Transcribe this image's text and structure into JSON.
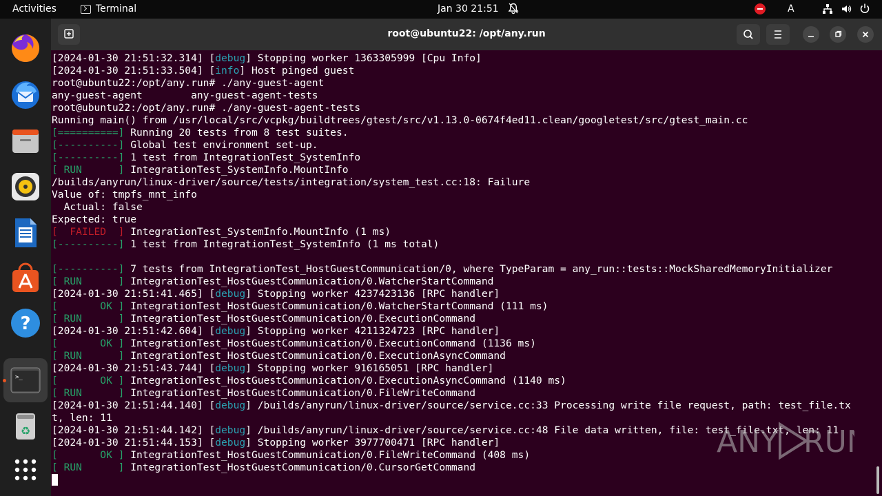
{
  "topbar": {
    "activities": "Activities",
    "app_name": "Terminal",
    "clock": "Jan 30  21:51",
    "keyboard_indicator": "A"
  },
  "dock": {
    "items": [
      {
        "name": "firefox-icon"
      },
      {
        "name": "thunderbird-icon"
      },
      {
        "name": "files-icon"
      },
      {
        "name": "rhythmbox-icon"
      },
      {
        "name": "libreoffice-writer-icon"
      },
      {
        "name": "app-center-icon"
      },
      {
        "name": "help-icon"
      },
      {
        "name": "terminal-icon"
      },
      {
        "name": "trash-icon"
      },
      {
        "name": "show-apps-icon"
      }
    ]
  },
  "window": {
    "title": "root@ubuntu22: /opt/any.run"
  },
  "colors": {
    "background": "#2c001e",
    "debug": "#2aa1b3",
    "green": "#26a269",
    "red": "#c01c28"
  },
  "terminal": {
    "lines": [
      [
        {
          "t": "[2024-01-30 21:51:32.314] ["
        },
        {
          "t": "debug",
          "c": "cyan"
        },
        {
          "t": "] Stopping worker 1363305999 [Cpu Info]"
        }
      ],
      [
        {
          "t": "[2024-01-30 21:51:33.504] ["
        },
        {
          "t": "info",
          "c": "cyan"
        },
        {
          "t": "] Host pinged guest"
        }
      ],
      [
        {
          "t": "root@ubuntu22:/opt/any.run# ./any-guest-agent"
        }
      ],
      [
        {
          "t": "any-guest-agent        any-guest-agent-tests"
        }
      ],
      [
        {
          "t": "root@ubuntu22:/opt/any.run# ./any-guest-agent-tests"
        }
      ],
      [
        {
          "t": "Running main() from /usr/local/src/vcpkg/buildtrees/gtest/src/v1.13.0-0674f4ed11.clean/googletest/src/gtest_main.cc"
        }
      ],
      [
        {
          "t": "[==========]",
          "c": "green"
        },
        {
          "t": " Running 20 tests from 8 test suites."
        }
      ],
      [
        {
          "t": "[----------]",
          "c": "green"
        },
        {
          "t": " Global test environment set-up."
        }
      ],
      [
        {
          "t": "[----------]",
          "c": "green"
        },
        {
          "t": " 1 test from IntegrationTest_SystemInfo"
        }
      ],
      [
        {
          "t": "[ RUN      ]",
          "c": "green"
        },
        {
          "t": " IntegrationTest_SystemInfo.MountInfo"
        }
      ],
      [
        {
          "t": "/builds/anyrun/linux-driver/source/tests/integration/system_test.cc:18: Failure"
        }
      ],
      [
        {
          "t": "Value of: tmpfs_mnt_info"
        }
      ],
      [
        {
          "t": "  Actual: false"
        }
      ],
      [
        {
          "t": "Expected: true"
        }
      ],
      [
        {
          "t": "[  FAILED  ]",
          "c": "red"
        },
        {
          "t": " IntegrationTest_SystemInfo.MountInfo (1 ms)"
        }
      ],
      [
        {
          "t": "[----------]",
          "c": "green"
        },
        {
          "t": " 1 test from IntegrationTest_SystemInfo (1 ms total)"
        }
      ],
      [
        {
          "t": ""
        }
      ],
      [
        {
          "t": "[----------]",
          "c": "green"
        },
        {
          "t": " 7 tests from IntegrationTest_HostGuestCommunication/0, where TypeParam = any_run::tests::MockSharedMemoryInitializer"
        }
      ],
      [
        {
          "t": "[ RUN      ]",
          "c": "green"
        },
        {
          "t": " IntegrationTest_HostGuestCommunication/0.WatcherStartCommand"
        }
      ],
      [
        {
          "t": "[2024-01-30 21:51:41.465] ["
        },
        {
          "t": "debug",
          "c": "cyan"
        },
        {
          "t": "] Stopping worker 4237423136 [RPC handler]"
        }
      ],
      [
        {
          "t": "[       OK ]",
          "c": "green"
        },
        {
          "t": " IntegrationTest_HostGuestCommunication/0.WatcherStartCommand (111 ms)"
        }
      ],
      [
        {
          "t": "[ RUN      ]",
          "c": "green"
        },
        {
          "t": " IntegrationTest_HostGuestCommunication/0.ExecutionCommand"
        }
      ],
      [
        {
          "t": "[2024-01-30 21:51:42.604] ["
        },
        {
          "t": "debug",
          "c": "cyan"
        },
        {
          "t": "] Stopping worker 4211324723 [RPC handler]"
        }
      ],
      [
        {
          "t": "[       OK ]",
          "c": "green"
        },
        {
          "t": " IntegrationTest_HostGuestCommunication/0.ExecutionCommand (1136 ms)"
        }
      ],
      [
        {
          "t": "[ RUN      ]",
          "c": "green"
        },
        {
          "t": " IntegrationTest_HostGuestCommunication/0.ExecutionAsyncCommand"
        }
      ],
      [
        {
          "t": "[2024-01-30 21:51:43.744] ["
        },
        {
          "t": "debug",
          "c": "cyan"
        },
        {
          "t": "] Stopping worker 916165051 [RPC handler]"
        }
      ],
      [
        {
          "t": "[       OK ]",
          "c": "green"
        },
        {
          "t": " IntegrationTest_HostGuestCommunication/0.ExecutionAsyncCommand (1140 ms)"
        }
      ],
      [
        {
          "t": "[ RUN      ]",
          "c": "green"
        },
        {
          "t": " IntegrationTest_HostGuestCommunication/0.FileWriteCommand"
        }
      ],
      [
        {
          "t": "[2024-01-30 21:51:44.140] ["
        },
        {
          "t": "debug",
          "c": "cyan"
        },
        {
          "t": "] /builds/anyrun/linux-driver/source/service.cc:33 Processing write file request, path: test_file.tx"
        }
      ],
      [
        {
          "t": "t, len: 11"
        }
      ],
      [
        {
          "t": "[2024-01-30 21:51:44.142] ["
        },
        {
          "t": "debug",
          "c": "cyan"
        },
        {
          "t": "] /builds/anyrun/linux-driver/source/service.cc:48 File data written, file: test_file.txt, len: 11"
        }
      ],
      [
        {
          "t": "[2024-01-30 21:51:44.153] ["
        },
        {
          "t": "debug",
          "c": "cyan"
        },
        {
          "t": "] Stopping worker 3977700471 [RPC handler]"
        }
      ],
      [
        {
          "t": "[       OK ]",
          "c": "green"
        },
        {
          "t": " IntegrationTest_HostGuestCommunication/0.FileWriteCommand (408 ms)"
        }
      ],
      [
        {
          "t": "[ RUN      ]",
          "c": "green"
        },
        {
          "t": " IntegrationTest_HostGuestCommunication/0.CursorGetCommand"
        }
      ]
    ]
  },
  "watermark": {
    "text_left": "ANY",
    "text_right": "RUN"
  }
}
